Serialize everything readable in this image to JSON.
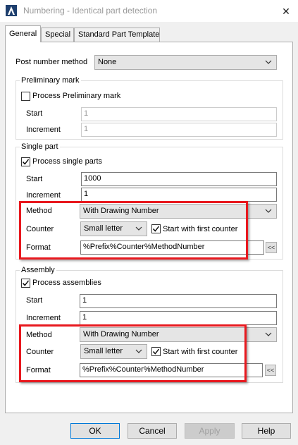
{
  "window": {
    "title": "Numbering - Identical part detection",
    "close_glyph": "✕"
  },
  "tabs": [
    {
      "label": "General",
      "active": true
    },
    {
      "label": "Special",
      "active": false
    },
    {
      "label": "Standard Part Template",
      "active": false
    }
  ],
  "post_number": {
    "label": "Post number method",
    "value": "None"
  },
  "preliminary": {
    "group_label": "Preliminary mark",
    "checkbox_label": "Process Preliminary mark",
    "checked": false,
    "start_label": "Start",
    "start_value": "1",
    "increment_label": "Increment",
    "increment_value": "1"
  },
  "single_part": {
    "group_label": "Single part",
    "checkbox_label": "Process single parts",
    "checked": true,
    "start_label": "Start",
    "start_value": "1000",
    "increment_label": "Increment",
    "increment_value": "1",
    "method_label": "Method",
    "method_value": "With Drawing Number",
    "counter_label": "Counter",
    "counter_value": "Small letter",
    "start_first_label": "Start with first counter",
    "start_first_checked": true,
    "format_label": "Format",
    "format_value": "%Prefix%Counter%MethodNumber",
    "format_btn": "<<"
  },
  "assembly": {
    "group_label": "Assembly",
    "checkbox_label": "Process assemblies",
    "checked": true,
    "start_label": "Start",
    "start_value": "1",
    "increment_label": "Increment",
    "increment_value": "1",
    "method_label": "Method",
    "method_value": "With Drawing Number",
    "counter_label": "Counter",
    "counter_value": "Small letter",
    "start_first_label": "Start with first counter",
    "start_first_checked": true,
    "format_label": "Format",
    "format_value": "%Prefix%Counter%MethodNumber",
    "format_btn": "<<"
  },
  "buttons": {
    "ok": "OK",
    "cancel": "Cancel",
    "apply": "Apply",
    "help": "Help"
  },
  "colors": {
    "highlight": "#e8181e",
    "accent": "#0078d7"
  }
}
